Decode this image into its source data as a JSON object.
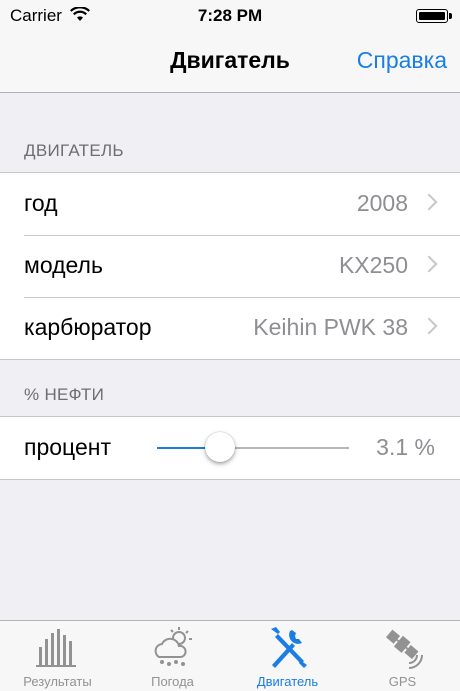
{
  "status": {
    "carrier": "Carrier",
    "time": "7:28 PM"
  },
  "nav": {
    "title": "Двигатель",
    "help": "Справка"
  },
  "engine": {
    "header": "ДВИГАТЕЛЬ",
    "rows": [
      {
        "label": "год",
        "value": "2008"
      },
      {
        "label": "модель",
        "value": "KX250"
      },
      {
        "label": "карбюратор",
        "value": "Keihin PWK 38"
      }
    ]
  },
  "oil": {
    "header": "% НЕФТИ",
    "label": "процент",
    "value": "3.1 %",
    "slider_fraction": 0.33
  },
  "tabs": [
    {
      "label": "Результаты",
      "icon": "bar-chart-icon"
    },
    {
      "label": "Погода",
      "icon": "weather-icon"
    },
    {
      "label": "Двигатель",
      "icon": "wrench-screwdriver-icon"
    },
    {
      "label": "GPS",
      "icon": "satellite-icon"
    }
  ],
  "colors": {
    "accent": "#1a7ee6",
    "inactive": "#929292",
    "background": "#efeff4"
  }
}
